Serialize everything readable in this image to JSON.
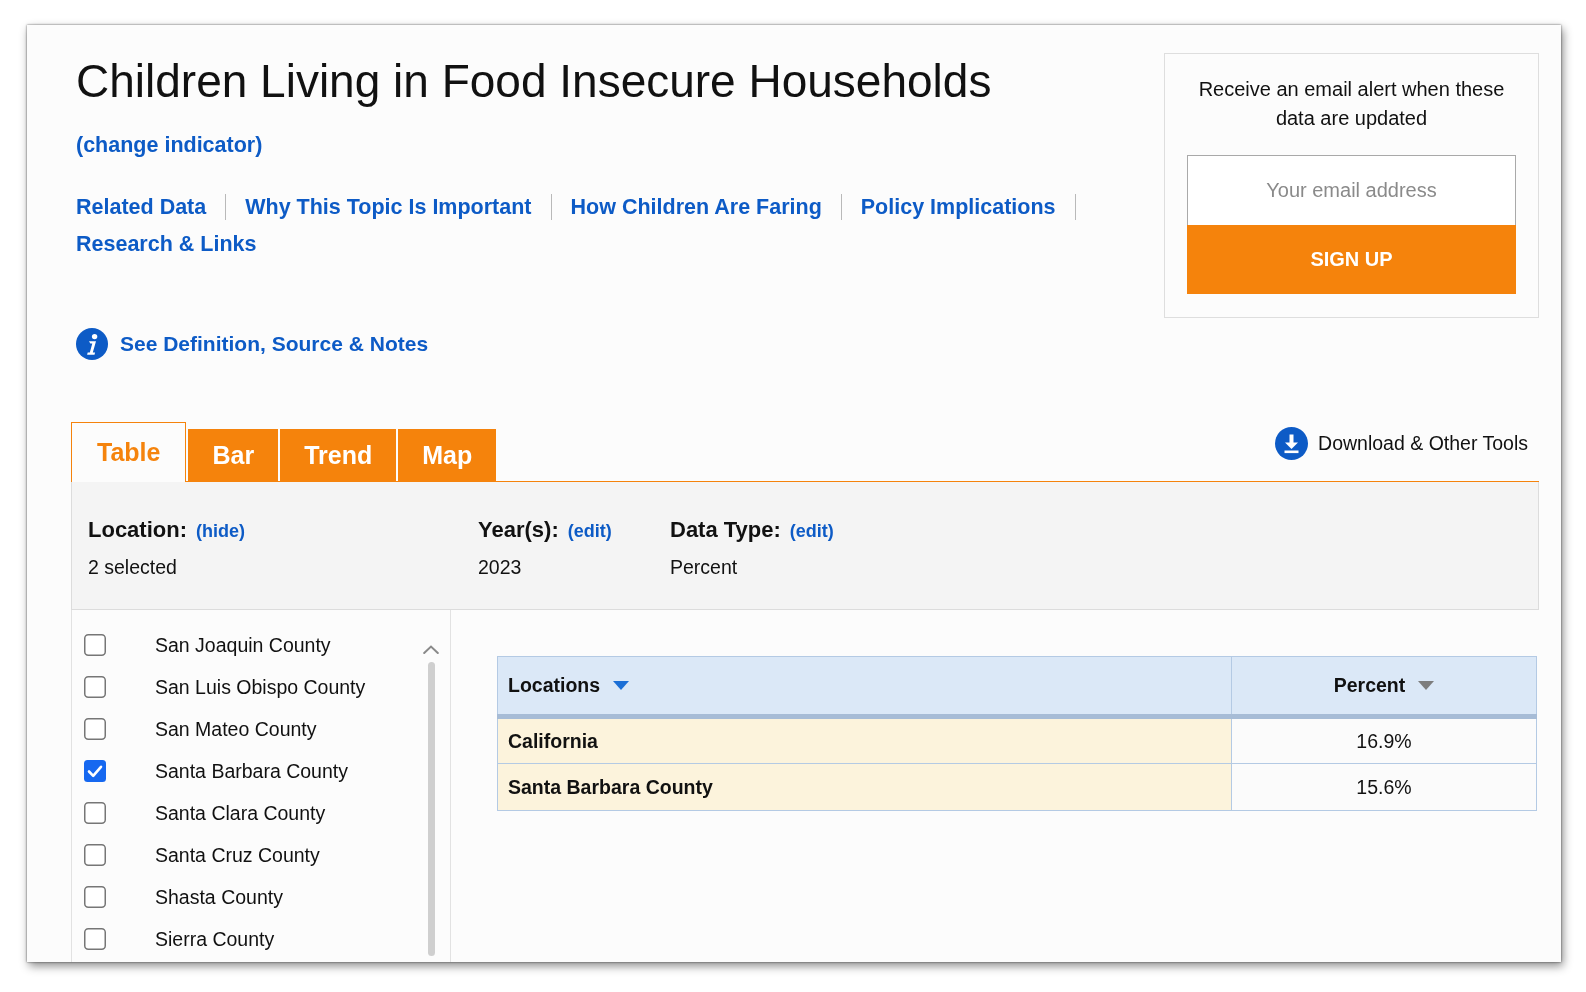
{
  "header": {
    "title": "Children Living in Food Insecure Households",
    "change_link": "(change indicator)",
    "nav_links": [
      "Related Data",
      "Why This Topic Is Important",
      "How Children Are Faring",
      "Policy Implications",
      "Research & Links"
    ],
    "definition_link": "See Definition, Source & Notes"
  },
  "alert": {
    "text": "Receive an email alert when these data are updated",
    "email_field": {
      "placeholder": "Your email address"
    },
    "button": "SIGN UP"
  },
  "tabs": [
    {
      "label": "Table",
      "selected": true
    },
    {
      "label": "Bar",
      "selected": false
    },
    {
      "label": "Trend",
      "selected": false
    },
    {
      "label": "Map",
      "selected": false
    }
  ],
  "download_link": "Download & Other Tools",
  "filters": [
    {
      "label": "Location:",
      "link": "(hide)",
      "value": "2 selected"
    },
    {
      "label": "Year(s):",
      "link": "(edit)",
      "value": "2023"
    },
    {
      "label": "Data Type:",
      "link": "(edit)",
      "value": "Percent"
    }
  ],
  "locations": [
    {
      "name": "San Joaquin County",
      "checked": false
    },
    {
      "name": "San Luis Obispo County",
      "checked": false
    },
    {
      "name": "San Mateo County",
      "checked": false
    },
    {
      "name": "Santa Barbara County",
      "checked": true
    },
    {
      "name": "Santa Clara County",
      "checked": false
    },
    {
      "name": "Santa Cruz County",
      "checked": false
    },
    {
      "name": "Shasta County",
      "checked": false
    },
    {
      "name": "Sierra County",
      "checked": false
    }
  ],
  "table": {
    "columns": [
      {
        "label": "Locations",
        "sorted": true
      },
      {
        "label": "Percent",
        "sorted": false
      }
    ],
    "rows": [
      {
        "cells": [
          "California",
          "16.9%"
        ]
      },
      {
        "cells": [
          "Santa Barbara County",
          "15.6%"
        ]
      }
    ]
  }
}
